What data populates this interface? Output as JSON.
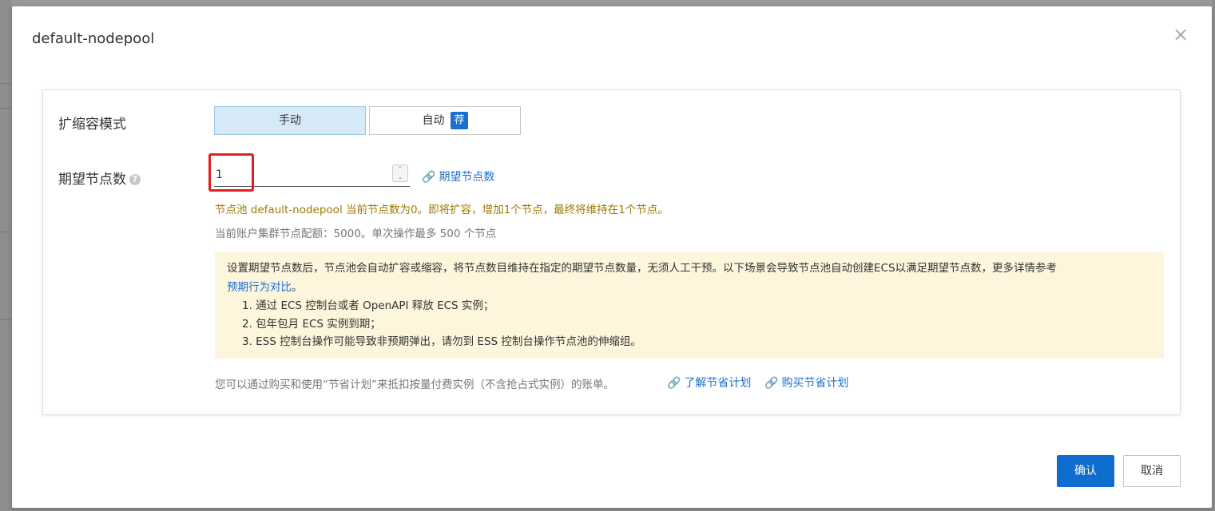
{
  "modal": {
    "title": "default-nodepool",
    "close_glyph": "×",
    "confirm_label": "确认",
    "cancel_label": "取消"
  },
  "scaling_mode": {
    "label": "扩缩容模式",
    "options": [
      {
        "label": "手动",
        "selected": true
      },
      {
        "label": "自动",
        "badge": "荐",
        "selected": false
      }
    ]
  },
  "desired_nodes": {
    "label": "期望节点数",
    "help_glyph": "?",
    "value": "1",
    "link_label": "期望节点数",
    "warning": "节点池 default-nodepool 当前节点数为0。即将扩容，增加1个节点，最终将维持在1个节点。",
    "quota": "当前账户集群节点配额：5000。单次操作最多 500 个节点"
  },
  "notice": {
    "lead": "设置期望节点数后，节点池会自动扩容或缩容，将节点数目维持在指定的期望节点数量，无须人工干预。以下场景会导致节点池自动创建ECS以满足期望节点数，更多详情参考",
    "link": "预期行为对比",
    "link_suffix": "。",
    "items": [
      "1. 通过 ECS 控制台或者 OpenAPI 释放 ECS 实例；",
      "2. 包年包月 ECS 实例到期；",
      "3. ESS 控制台操作可能导致非预期弹出，请勿到 ESS 控制台操作节点池的伸缩组。"
    ]
  },
  "savings": {
    "text": "您可以通过购买和使用“节省计划”来抵扣按量付费实例（不含抢占式实例）的账单。",
    "learn_link": "了解节省计划",
    "buy_link": "购买节省计划"
  },
  "icons": {
    "link": "link-icon",
    "help": "help-icon",
    "close": "close-icon"
  },
  "colors": {
    "primary": "#0f6dcf",
    "warning_text": "#a07a00",
    "notice_bg": "#fdf5dc",
    "highlight": "#e02020"
  }
}
